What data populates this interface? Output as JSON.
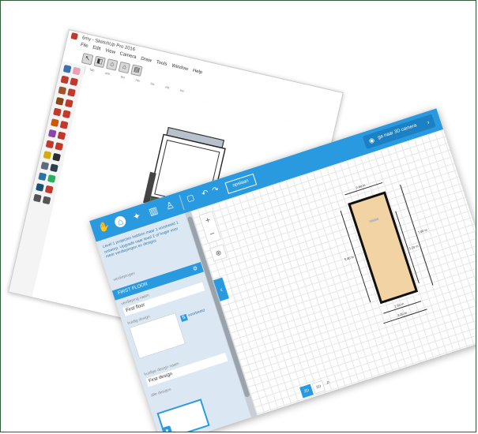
{
  "sketchup": {
    "title": "6my - SketchUp Pro 2016",
    "menus": [
      "File",
      "Edit",
      "View",
      "Camera",
      "Draw",
      "Tools",
      "Window",
      "Help"
    ],
    "toolbar_icons": [
      "select-icon",
      "eraser-icon",
      "home-icon",
      "house-icon",
      "scenes-icon"
    ],
    "ruler_tabs": [
      "sim",
      "ths",
      "hts",
      "tss",
      "vld",
      "tov"
    ],
    "ruler_corner": "Tab"
  },
  "floorplanner": {
    "nav_icons": [
      "hand-icon",
      "house-icon",
      "wand-icon",
      "book-icon",
      "figure-icon"
    ],
    "save_label": "opslaan",
    "camera_label": "ga naar 3D camera",
    "promo_text": "Level 1 projecten hebben maar 1 voorbeeld 1 ontwerp. Upgrade naar level 2 of hoger voor meer verdiepingen en designs",
    "floors_label": "verdiepingen",
    "floor_title": "FIRST FLOOR",
    "floor_name_label": "verdieping naam",
    "floor_name_value": "First floor",
    "design_label": "huidig design",
    "toggle_label": "voorbeeld",
    "design_name_label": "huidige design naam",
    "design_name_value": "First design",
    "all_designs_label": "alle designs",
    "view_buttons": [
      "2D",
      "3D"
    ],
    "dimensions": {
      "top": "2.60 m",
      "right": "7.00 m",
      "left": "5.40 m",
      "mid": "5.20 m",
      "bottom1": "2.60 m",
      "bottom2": "3.00 m"
    },
    "colors": {
      "accent": "#2a9ae0",
      "room_fill": "#f2d3a4"
    }
  }
}
